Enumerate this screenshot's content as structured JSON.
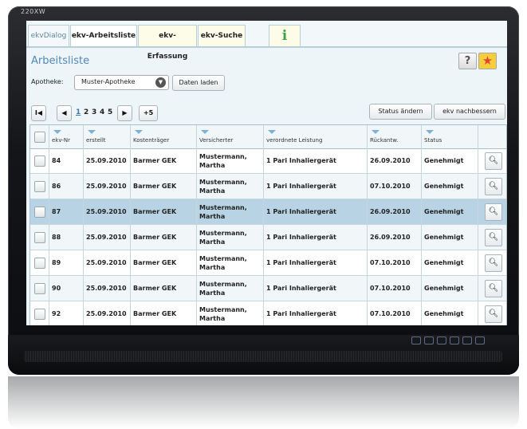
{
  "monitor": {
    "label": "220XW"
  },
  "tabs": [
    {
      "label": "ekvDialog"
    },
    {
      "label": "ekv-Arbeitsliste"
    },
    {
      "label": "ekv-Erfassung"
    },
    {
      "label": "ekv-Suche"
    },
    {
      "label": "i"
    }
  ],
  "page": {
    "title": "Arbeitsliste",
    "help_label": "?",
    "fav_icon": "★"
  },
  "filter": {
    "apotheke_label": "Apotheke:",
    "apotheke_value": "Muster-Apotheke",
    "load_button": "Daten laden"
  },
  "pager": {
    "first": "I◀",
    "prev": "◀",
    "pages": [
      "1",
      "2",
      "3",
      "4",
      "5"
    ],
    "next": "▶",
    "plus": "+5"
  },
  "actions": {
    "status_change": "Status ändern",
    "improve": "ekv nachbessern"
  },
  "table": {
    "headers": [
      "ekv-Nr",
      "erstellt",
      "Kostenträger",
      "Versicherter",
      "verordnete Leistung",
      "Rückantw.",
      "Status"
    ],
    "rows": [
      {
        "nr": "84",
        "erstellt": "25.09.2010",
        "kostentraeger": "Barmer GEK",
        "versicherter": "Mustermann, Martha",
        "leistung": "1 Pari Inhaliergerät",
        "rueckantw": "26.09.2010",
        "status": "Genehmigt"
      },
      {
        "nr": "86",
        "erstellt": "25.09.2010",
        "kostentraeger": "Barmer GEK",
        "versicherter": "Mustermann, Martha",
        "leistung": "1 Pari Inhaliergerät",
        "rueckantw": "07.10.2010",
        "status": "Genehmigt"
      },
      {
        "nr": "87",
        "erstellt": "25.09.2010",
        "kostentraeger": "Barmer GEK",
        "versicherter": "Mustermann, Martha",
        "leistung": "1 Pari Inhaliergerät",
        "rueckantw": "26.09.2010",
        "status": "Genehmigt"
      },
      {
        "nr": "88",
        "erstellt": "25.09.2010",
        "kostentraeger": "Barmer GEK",
        "versicherter": "Mustermann, Martha",
        "leistung": "1 Pari Inhaliergerät",
        "rueckantw": "26.09.2010",
        "status": "Genehmigt"
      },
      {
        "nr": "89",
        "erstellt": "25.09.2010",
        "kostentraeger": "Barmer GEK",
        "versicherter": "Mustermann, Martha",
        "leistung": "1 Pari Inhaliergerät",
        "rueckantw": "07.10.2010",
        "status": "Genehmigt"
      },
      {
        "nr": "90",
        "erstellt": "25.09.2010",
        "kostentraeger": "Barmer GEK",
        "versicherter": "Mustermann, Martha",
        "leistung": "1 Pari Inhaliergerät",
        "rueckantw": "07.10.2010",
        "status": "Genehmigt"
      },
      {
        "nr": "92",
        "erstellt": "25.09.2010",
        "kostentraeger": "Barmer GEK",
        "versicherter": "Mustermann, Martha",
        "leistung": "1 Pari Inhaliergerät",
        "rueckantw": "07.10.2010",
        "status": "Genehmigt"
      }
    ],
    "selected_row": 2,
    "row_action_icon": "magnifier-icon"
  },
  "colors": {
    "accent": "#4f89b6",
    "selected_row": "#b8d4e4",
    "info_icon": "#3ea347",
    "star_bg": "#f6ce3c"
  }
}
